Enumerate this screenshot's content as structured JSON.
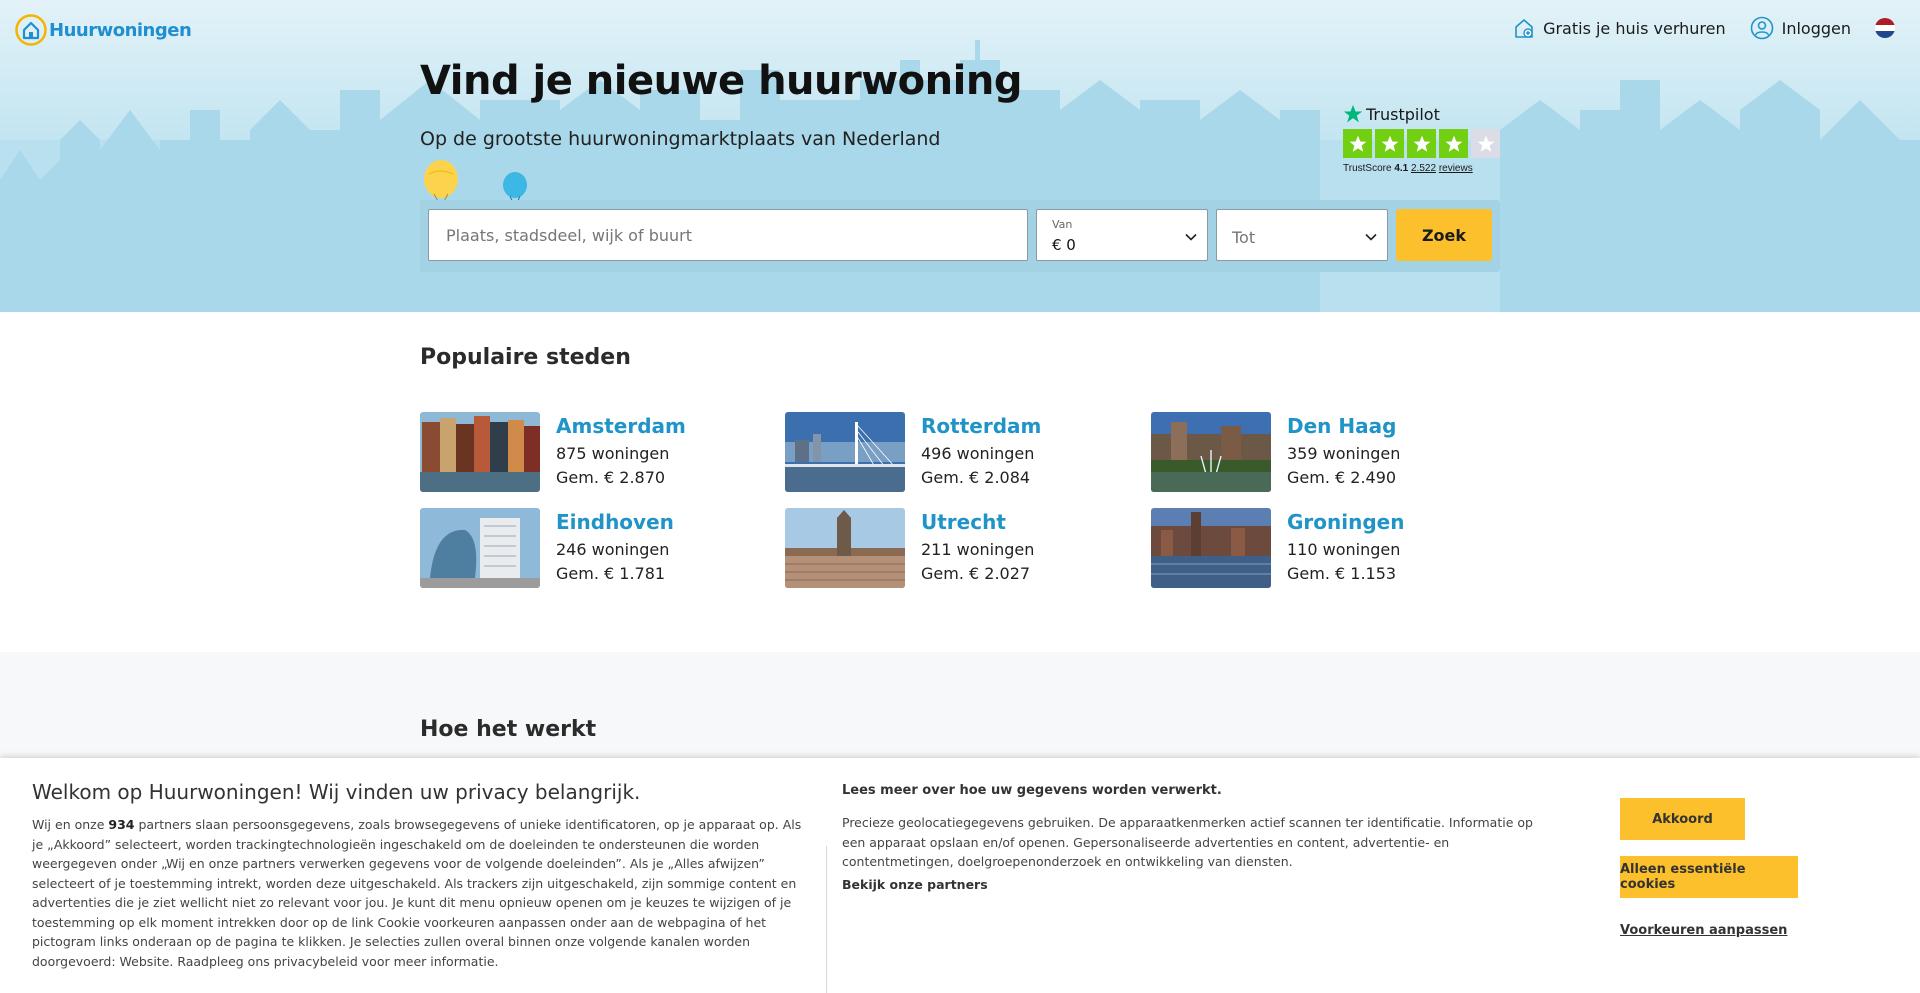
{
  "header": {
    "logo_text": "Huurwoningen",
    "nav_rent_out": "Gratis je huis verhuren",
    "nav_login": "Inloggen"
  },
  "hero": {
    "title": "Vind je nieuwe huurwoning",
    "subtitle": "Op de grootste huurwoningmarktplaats van Nederland"
  },
  "trustpilot": {
    "brand": "Trustpilot",
    "score_label": "TrustScore",
    "score": "4.1",
    "review_count": "2.522",
    "reviews_label": "reviews",
    "rating_stars": 4.1
  },
  "search": {
    "placeholder": "Plaats, stadsdeel, wijk of buurt",
    "from_label": "Van",
    "from_value": "€ 0",
    "to_placeholder": "Tot",
    "button": "Zoek"
  },
  "popular": {
    "title": "Populaire steden",
    "cities": [
      {
        "name": "Amsterdam",
        "count": "875 woningen",
        "avg": "Gem. € 2.870"
      },
      {
        "name": "Rotterdam",
        "count": "496 woningen",
        "avg": "Gem. € 2.084"
      },
      {
        "name": "Den Haag",
        "count": "359 woningen",
        "avg": "Gem. € 2.490"
      },
      {
        "name": "Eindhoven",
        "count": "246 woningen",
        "avg": "Gem. € 1.781"
      },
      {
        "name": "Utrecht",
        "count": "211 woningen",
        "avg": "Gem. € 2.027"
      },
      {
        "name": "Groningen",
        "count": "110 woningen",
        "avg": "Gem. € 1.153"
      }
    ]
  },
  "how": {
    "title": "Hoe het werkt"
  },
  "cookie": {
    "title": "Welkom op Huurwoningen! Wij vinden uw privacy belangrijk.",
    "body_pre": "Wij en onze ",
    "partner_count": "934",
    "body_post": " partners slaan persoonsgegevens, zoals browsegegevens of unieke identificatoren, op je apparaat op. Als je „Akkoord” selecteert, worden trackingtechnologieën ingeschakeld om de doeleinden te ondersteunen die worden weergegeven onder „Wij en onze partners verwerken gegevens voor de volgende doeleinden”. Als je „Alles afwijzen” selecteert of je toestemming intrekt, worden deze uitgeschakeld. Als trackers zijn uitgeschakeld, zijn sommige content en advertenties die je ziet wellicht niet zo relevant voor jou. Je kunt dit menu opnieuw openen om je keuzes te wijzigen of je toestemming op elk moment intrekken door op de link Cookie voorkeuren aanpassen onder aan de webpagina of het pictogram links onderaan op de pagina te klikken. Je selecties zullen overal binnen onze volgende kanalen worden doorgevoerd: Website. Raadpleeg ons privacybeleid voor meer informatie.",
    "mid_title": "Lees meer over hoe uw gegevens worden verwerkt.",
    "mid_body": "Precieze geolocatiegegevens gebruiken. De apparaatkenmerken actief scannen ter identificatie. Informatie op een apparaat opslaan en/of openen. Gepersonaliseerde advertenties en content, advertentie- en contentmetingen, doelgroepenonderzoek en ontwikkeling van diensten.",
    "partners_link": "Bekijk onze partners",
    "accept": "Akkoord",
    "essential": "Alleen essentiële cookies",
    "preferences": "Voorkeuren aanpassen"
  },
  "colors": {
    "accent_yellow": "#fcc02d",
    "link_blue": "#2094c7",
    "trustpilot_green": "#73cf11"
  }
}
